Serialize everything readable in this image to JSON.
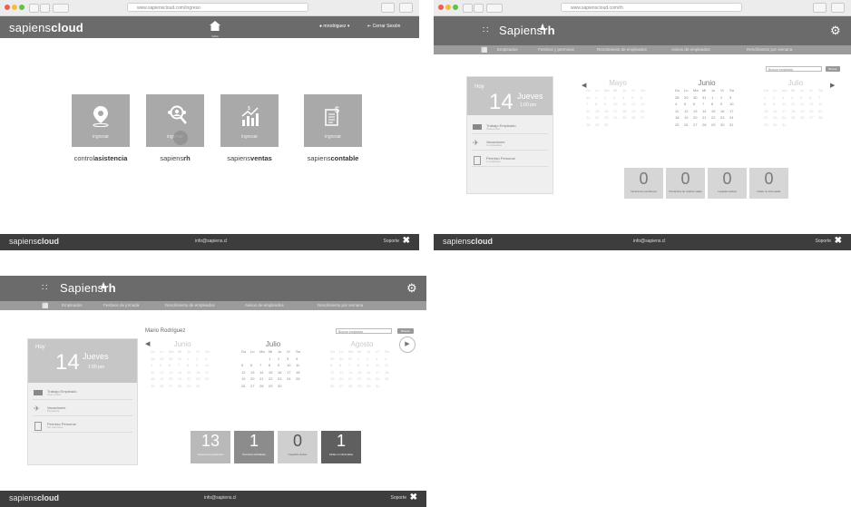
{
  "panel1": {
    "url": "www.sapienscloud.com/ingreso",
    "brand_light": "sapiens",
    "brand_bold": "cloud",
    "home_label": "Inicio",
    "user_label": "mrodriguez",
    "logout_label": "Cerrar Sesión",
    "tiles": [
      {
        "icon": "location-pin-icon",
        "action": "ingresar",
        "caption_light": "control",
        "caption_bold": "asistencia"
      },
      {
        "icon": "people-search-icon",
        "action": "ingresar",
        "caption_light": "sapiens",
        "caption_bold": "rh"
      },
      {
        "icon": "sales-chart-icon",
        "action": "ingresar",
        "caption_light": "sapiens",
        "caption_bold": "ventas"
      },
      {
        "icon": "accounting-doc-icon",
        "action": "ingresar",
        "caption_light": "sapiens",
        "caption_bold": "contable"
      }
    ],
    "footer": {
      "brand_light": "sapiens",
      "brand_bold": "cloud",
      "email": "info@sapiens.cl",
      "support": "Soporte"
    }
  },
  "panel2": {
    "url": "www.sapienscloud.com/rh",
    "brand_light": "Sapiens",
    "brand_bold": "rh",
    "nav": [
      "Empleados",
      "Festivos y permisos",
      "Rendimiento de empleados",
      "Avisos de empleados",
      "Rendimiento por semana"
    ],
    "today_label": "Hoy",
    "day_number": "14",
    "weekday": "Jueves",
    "time": "1:00 pm",
    "events": [
      {
        "icon": "calendar-card-icon",
        "title": "Trabajo Empleado",
        "sub": "Todo el día"
      },
      {
        "icon": "plane-icon",
        "title": "Vacaciones",
        "sub": "2 empleados"
      },
      {
        "icon": "document-icon",
        "title": "Permiso Personal",
        "sub": "1 empleado"
      }
    ],
    "search_placeholder": "Buscar empleado",
    "search_button": "Buscar",
    "months": [
      {
        "name": "Mayo",
        "days": [
          "Do",
          "Lu",
          "Ma",
          "Mi",
          "Ju",
          "Vi",
          "Sa",
          "30",
          "1",
          "2",
          "3",
          "4",
          "5",
          "6",
          "7",
          "8",
          "9",
          "10",
          "11",
          "12",
          "13",
          "14",
          "15",
          "16",
          "17",
          "18",
          "19",
          "20",
          "21",
          "22",
          "23",
          "24",
          "25",
          "26",
          "27",
          "28",
          "29",
          "30"
        ]
      },
      {
        "name": "Junio",
        "days": [
          "Do",
          "Lu",
          "Ma",
          "Mi",
          "Ju",
          "Vi",
          "Sa",
          "28",
          "29",
          "30",
          "31",
          "1",
          "2",
          "3",
          "4",
          "5",
          "6",
          "7",
          "8",
          "9",
          "10",
          "11",
          "12",
          "13",
          "14",
          "15",
          "16",
          "17",
          "18",
          "19",
          "20",
          "21",
          "22",
          "23",
          "24",
          "25",
          "26",
          "27",
          "28",
          "29",
          "30",
          "31"
        ]
      },
      {
        "name": "Julio",
        "days": [
          "Do",
          "Lu",
          "Ma",
          "Mi",
          "Ju",
          "Vi",
          "Sa",
          "1",
          "2",
          "3",
          "4",
          "5",
          "6",
          "7",
          "8",
          "9",
          "10",
          "11",
          "12",
          "13",
          "14",
          "15",
          "16",
          "17",
          "18",
          "19",
          "20",
          "21",
          "22",
          "23",
          "24",
          "25",
          "26",
          "27",
          "28",
          "29",
          "30",
          "31"
        ]
      }
    ],
    "stats": [
      {
        "value": "0",
        "label": "Vacaciones pendientes"
      },
      {
        "value": "0",
        "label": "Pendientes de notificar salida"
      },
      {
        "value": "0",
        "label": "Llegadas tardías"
      },
      {
        "value": "0",
        "label": "Faltas no informadas"
      }
    ],
    "footer": {
      "brand_light": "sapiens",
      "brand_bold": "cloud",
      "email": "info@sapiens.cl",
      "support": "Soporte"
    }
  },
  "panel3": {
    "brand_light": "Sapiens",
    "brand_bold": "rh",
    "nav": [
      "Empleados",
      "Festivos de jornada",
      "Rendimiento de empleados",
      "Avisos de empleados",
      "Rendimiento por semana"
    ],
    "employee_name": "Mario Rodríguez",
    "today_label": "Hoy",
    "day_number": "14",
    "weekday": "Jueves",
    "time": "1:00 pm",
    "events": [
      {
        "icon": "calendar-card-icon",
        "title": "Trabajo Empleado",
        "sub": "Todo el día"
      },
      {
        "icon": "plane-icon",
        "title": "Vacaciones",
        "sub": "Pendiente"
      },
      {
        "icon": "document-icon",
        "title": "Permiso Personal",
        "sub": "Sin permisos"
      }
    ],
    "search_placeholder": "Buscar empleado",
    "search_button": "Buscar",
    "months": [
      {
        "name": "Junio",
        "days": [
          "Do",
          "Lu",
          "Ma",
          "Mi",
          "Ju",
          "Vi",
          "Sa",
          "28",
          "29",
          "30",
          "31",
          "1",
          "2",
          "3",
          "4",
          "5",
          "6",
          "7",
          "8",
          "9",
          "10",
          "11",
          "12",
          "13",
          "14",
          "15",
          "16",
          "17",
          "18",
          "19",
          "20",
          "21",
          "22",
          "23",
          "24",
          "25",
          "26",
          "27",
          "28",
          "29",
          "30"
        ]
      },
      {
        "name": "Julio",
        "days": [
          "Do",
          "Lu",
          "Ma",
          "Mi",
          "Ju",
          "Vi",
          "Sa",
          "",
          "",
          "",
          "1",
          "2",
          "3",
          "4",
          "5",
          "6",
          "7",
          "8",
          "9",
          "10",
          "11",
          "12",
          "13",
          "14",
          "15",
          "16",
          "17",
          "18",
          "19",
          "20",
          "21",
          "22",
          "23",
          "24",
          "25",
          "26",
          "27",
          "28",
          "29",
          "30"
        ]
      },
      {
        "name": "Agosto",
        "days": [
          "Do",
          "Lu",
          "Ma",
          "Mi",
          "Ju",
          "Vi",
          "Sa",
          "29",
          "30",
          "31",
          "1",
          "2",
          "3",
          "4",
          "5",
          "6",
          "7",
          "8",
          "9",
          "10",
          "11",
          "12",
          "13",
          "14",
          "15",
          "16",
          "17",
          "18",
          "19",
          "20",
          "21",
          "22",
          "23",
          "24",
          "25",
          "26",
          "27",
          "28",
          "29",
          "30",
          "31"
        ]
      }
    ],
    "stats": [
      {
        "value": "13",
        "label": "Vacaciones pendientes"
      },
      {
        "value": "1",
        "label": "Permisos solicitados"
      },
      {
        "value": "0",
        "label": "Llegadas tardías"
      },
      {
        "value": "1",
        "label": "Faltas no informadas"
      }
    ],
    "footer": {
      "brand_light": "sapiens",
      "brand_bold": "cloud",
      "email": "info@sapiens.cl",
      "support": "Soporte"
    }
  }
}
